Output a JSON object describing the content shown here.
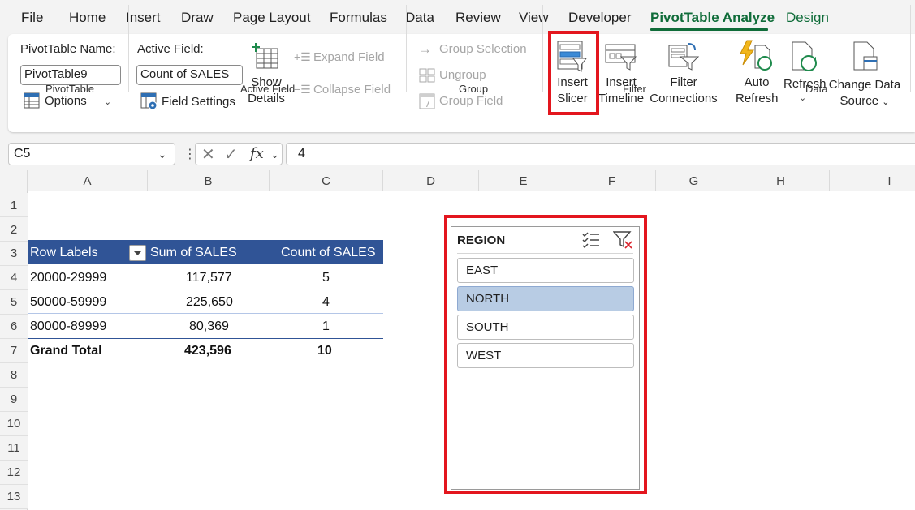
{
  "menu": {
    "tabs": [
      "File",
      "Home",
      "Insert",
      "Draw",
      "Page Layout",
      "Formulas",
      "Data",
      "Review",
      "View",
      "Developer",
      "PivotTable Analyze",
      "Design"
    ]
  },
  "ribbon": {
    "pivottable": {
      "name_label": "PivotTable Name:",
      "name_value": "PivotTable9",
      "options_label": "Options",
      "group_label": "PivotTable"
    },
    "active_field": {
      "label": "Active Field:",
      "value": "Count of SALES",
      "field_settings": "Field Settings",
      "show_details_1": "Show",
      "show_details_2": "Details",
      "expand_field": "Expand Field",
      "collapse_field": "Collapse Field",
      "group_label": "Active Field"
    },
    "group": {
      "group_selection": "Group Selection",
      "ungroup": "Ungroup",
      "group_field": "Group Field",
      "group_label": "Group"
    },
    "filter": {
      "insert_slicer_1": "Insert",
      "insert_slicer_2": "Slicer",
      "insert_timeline_1": "Insert",
      "insert_timeline_2": "Timeline",
      "filter_connections_1": "Filter",
      "filter_connections_2": "Connections",
      "group_label": "Filter"
    },
    "data": {
      "auto_refresh_1": "Auto",
      "auto_refresh_2": "Refresh",
      "refresh": "Refresh",
      "change_source_1": "Change Data",
      "change_source_2": "Source",
      "group_label": "Data"
    }
  },
  "formula_bar": {
    "name_box": "C5",
    "formula": "4",
    "fx": "fx"
  },
  "grid": {
    "columns": [
      "A",
      "B",
      "C",
      "D",
      "E",
      "F",
      "G",
      "H",
      "I"
    ],
    "rows": [
      "1",
      "2",
      "3",
      "4",
      "5",
      "6",
      "7",
      "8",
      "9",
      "10",
      "11",
      "12",
      "13"
    ]
  },
  "pivot": {
    "headers": [
      "Row Labels",
      "Sum of SALES",
      "Count of SALES"
    ],
    "rows": [
      [
        "20000-29999",
        "117,577",
        "5"
      ],
      [
        "50000-59999",
        "225,650",
        "4"
      ],
      [
        "80000-89999",
        "80,369",
        "1"
      ]
    ],
    "grand_total": [
      "Grand Total",
      "423,596",
      "10"
    ]
  },
  "slicer": {
    "title": "REGION",
    "items": [
      "EAST",
      "NORTH",
      "SOUTH",
      "WEST"
    ],
    "selected": "NORTH"
  },
  "colors": {
    "accent": "#0f6c39",
    "pivot_header": "#305496",
    "highlight": "#e3161e",
    "slicer_selected": "#b8cce4"
  }
}
